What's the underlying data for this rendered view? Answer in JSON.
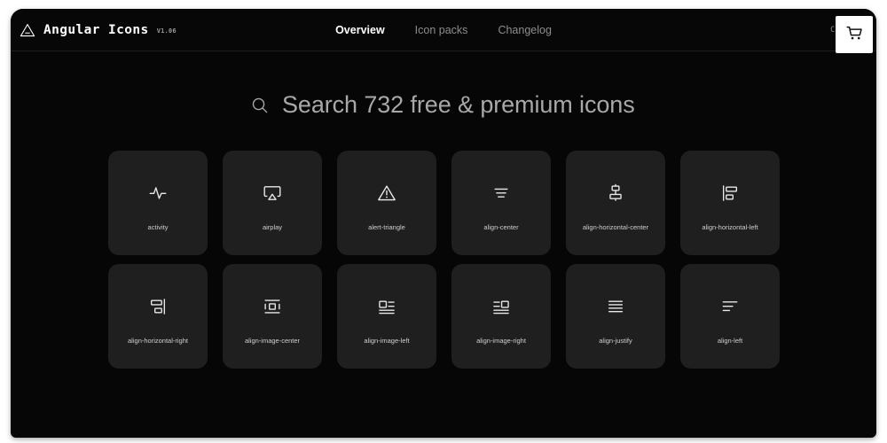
{
  "header": {
    "logo_icon": "angular-triangle-logo",
    "brand_name": "Angular Icons",
    "version": "V1.06",
    "nav": [
      {
        "label": "Overview",
        "active": true
      },
      {
        "label": "Icon packs",
        "active": false
      },
      {
        "label": "Changelog",
        "active": false
      }
    ],
    "created_by_label": "Created b",
    "cart_icon": "shopping-cart-icon"
  },
  "search": {
    "icon": "search-icon",
    "value": "",
    "placeholder": "Search 732 free & premium icons",
    "icon_count": 732
  },
  "grid": {
    "columns": 6,
    "cards": [
      {
        "label": "activity",
        "icon": "activity-icon"
      },
      {
        "label": "airplay",
        "icon": "airplay-icon"
      },
      {
        "label": "alert-triangle",
        "icon": "alert-triangle-icon"
      },
      {
        "label": "align-center",
        "icon": "align-center-icon"
      },
      {
        "label": "align-horizontal-center",
        "icon": "align-horizontal-center-icon"
      },
      {
        "label": "align-horizontal-left",
        "icon": "align-horizontal-left-icon"
      },
      {
        "label": "align-horizontal-right",
        "icon": "align-horizontal-right-icon"
      },
      {
        "label": "align-image-center",
        "icon": "align-image-center-icon"
      },
      {
        "label": "align-image-left",
        "icon": "align-image-left-icon"
      },
      {
        "label": "align-image-right",
        "icon": "align-image-right-icon"
      },
      {
        "label": "align-justify",
        "icon": "align-justify-icon"
      },
      {
        "label": "align-left",
        "icon": "align-left-icon"
      }
    ]
  },
  "colors": {
    "page_background": "#ffffff",
    "window_background": "#060606",
    "header_background": "#070707",
    "card_background": "#1f1f1f",
    "accent_white": "#ffffff",
    "muted_text": "#8d8d8d",
    "label_text": "#cfcfcf"
  }
}
